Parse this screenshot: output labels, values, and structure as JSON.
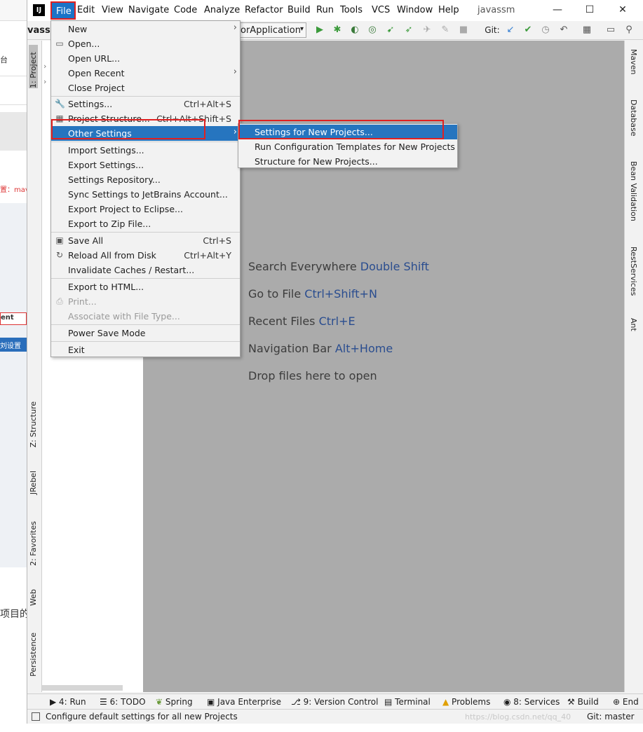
{
  "background": {
    "snippets": [
      "台",
      "项目的",
      "ent",
      "刘设置",
      "置：mav"
    ]
  },
  "titlebar": {
    "logo_text": "IJ",
    "window_title": "javassm",
    "menus": [
      "File",
      "Edit",
      "View",
      "Navigate",
      "Code",
      "Analyze",
      "Refactor",
      "Build",
      "Run",
      "Tools",
      "VCS",
      "Window",
      "Help"
    ],
    "controls": {
      "minimize": "—",
      "maximize": "☐",
      "close": "✕"
    }
  },
  "toolbar": {
    "project_name": "vassm",
    "run_config": "orApplication",
    "git_label": "Git:"
  },
  "left_tabs": [
    "1: Project",
    "Z: Structure",
    "JRebel",
    "2: Favorites",
    "Web",
    "Persistence"
  ],
  "right_tabs": [
    "Maven",
    "Database",
    "Bean Validation",
    "RestServices",
    "Ant"
  ],
  "file_menu": {
    "items": [
      {
        "label": "New",
        "shortcut": "",
        "submenu": true
      },
      {
        "label": "Open...",
        "shortcut": ""
      },
      {
        "label": "Open URL...",
        "shortcut": ""
      },
      {
        "label": "Open Recent",
        "shortcut": "",
        "submenu": true
      },
      {
        "label": "Close Project",
        "shortcut": ""
      },
      {
        "label": "Settings...",
        "shortcut": "Ctrl+Alt+S"
      },
      {
        "label": "Project Structure...",
        "shortcut": "Ctrl+Alt+Shift+S"
      },
      {
        "label": "Other Settings",
        "shortcut": "",
        "submenu": true,
        "selected": true
      },
      {
        "label": "Import Settings...",
        "shortcut": ""
      },
      {
        "label": "Export Settings...",
        "shortcut": ""
      },
      {
        "label": "Settings Repository...",
        "shortcut": ""
      },
      {
        "label": "Sync Settings to JetBrains Account...",
        "shortcut": ""
      },
      {
        "label": "Export Project to Eclipse...",
        "shortcut": ""
      },
      {
        "label": "Export to Zip File...",
        "shortcut": ""
      },
      {
        "label": "Save All",
        "shortcut": "Ctrl+S"
      },
      {
        "label": "Reload All from Disk",
        "shortcut": "Ctrl+Alt+Y"
      },
      {
        "label": "Invalidate Caches / Restart...",
        "shortcut": ""
      },
      {
        "label": "Export to HTML...",
        "shortcut": ""
      },
      {
        "label": "Print...",
        "shortcut": "",
        "disabled": true
      },
      {
        "label": "Associate with File Type...",
        "shortcut": "",
        "disabled": true
      },
      {
        "label": "Power Save Mode",
        "shortcut": ""
      },
      {
        "label": "Exit",
        "shortcut": ""
      }
    ]
  },
  "other_settings_submenu": {
    "items": [
      {
        "label": "Settings for New Projects...",
        "selected": true
      },
      {
        "label": "Run Configuration Templates for New Projects"
      },
      {
        "label": "Structure for New Projects..."
      }
    ]
  },
  "editor_hints": [
    {
      "text": "Search Everywhere",
      "key": "Double Shift"
    },
    {
      "text": "Go to File",
      "key": "Ctrl+Shift+N"
    },
    {
      "text": "Recent Files",
      "key": "Ctrl+E"
    },
    {
      "text": "Navigation Bar",
      "key": "Alt+Home"
    },
    {
      "text": "Drop files here to open",
      "key": ""
    }
  ],
  "bottom_tabs": [
    "4: Run",
    "6: TODO",
    "Spring",
    "Java Enterprise",
    "9: Version Control",
    "Terminal",
    "Problems",
    "8: Services",
    "Build",
    "End"
  ],
  "status": {
    "message": "Configure default settings for all new Projects",
    "git": "Git: master",
    "watermark": "https://blog.csdn.net/qq_40"
  }
}
